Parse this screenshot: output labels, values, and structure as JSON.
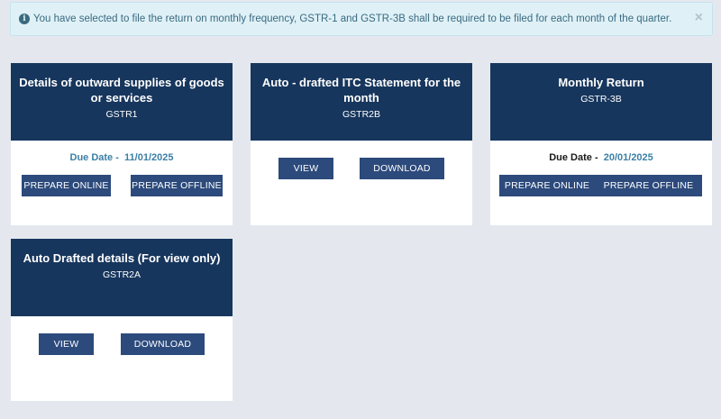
{
  "alert": {
    "icon": "info-circle-icon",
    "message": "You have selected to file the return on monthly frequency, GSTR-1 and GSTR-3B shall be required to be filed for each month of the quarter.",
    "close": "×"
  },
  "cards": {
    "gstr1": {
      "title": "Details of outward supplies of goods or services",
      "subtitle": "GSTR1",
      "due_label": "Due Date -",
      "due_value": "11/01/2025",
      "btn1": "PREPARE ONLINE",
      "btn2": "PREPARE OFFLINE"
    },
    "gstr2b": {
      "title": "Auto - drafted ITC Statement for the month",
      "subtitle": "GSTR2B",
      "btn1": "VIEW",
      "btn2": "DOWNLOAD"
    },
    "gstr3b": {
      "title": "Monthly Return",
      "subtitle": "GSTR-3B",
      "due_label": "Due Date -",
      "due_value": "20/01/2025",
      "btn1": "PREPARE ONLINE",
      "btn2": "PREPARE OFFLINE"
    },
    "gstr2a": {
      "title": "Auto Drafted details (For view only)",
      "subtitle": "GSTR2A",
      "btn1": "VIEW",
      "btn2": "DOWNLOAD"
    }
  },
  "colors": {
    "header": "#17365d",
    "button": "#2c4a7c",
    "due_accent": "#3b7fa6"
  }
}
